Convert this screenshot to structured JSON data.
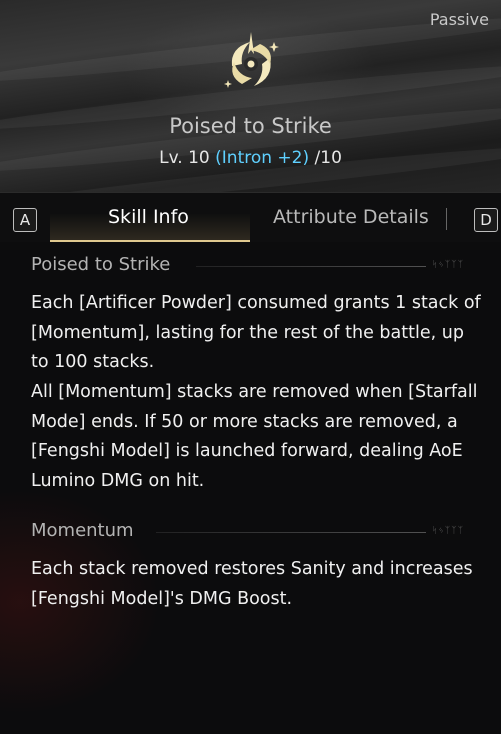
{
  "header": {
    "badge": "Passive",
    "skill_name": "Poised to Strike",
    "level_prefix": "Lv. 10",
    "intron": "(Intron +2)",
    "level_suffix": "/10",
    "icon": "shuriken-emblem-icon"
  },
  "tabs": {
    "left_key": "A",
    "right_key": "D",
    "items": [
      "Skill Info",
      "Attribute Details"
    ]
  },
  "sections": [
    {
      "title": "Poised to Strike",
      "paragraphs": [
        "Each [Artificer Powder] consumed grants 1 stack of [Momentum], lasting for the rest of the battle, up to 100 stacks.",
        "All [Momentum] stacks are removed when [Starfall Mode] ends. If 50 or more stacks are removed, a [Fengshi Model] is launched forward, dealing AoE Lumino DMG on hit."
      ]
    },
    {
      "title": "Momentum",
      "paragraphs": [
        "Each stack removed restores Sanity and increases [Fengshi Model]'s DMG Boost."
      ]
    }
  ],
  "colors": {
    "intron": "#5fd0ff",
    "tab_underline": "#e0c98f"
  }
}
